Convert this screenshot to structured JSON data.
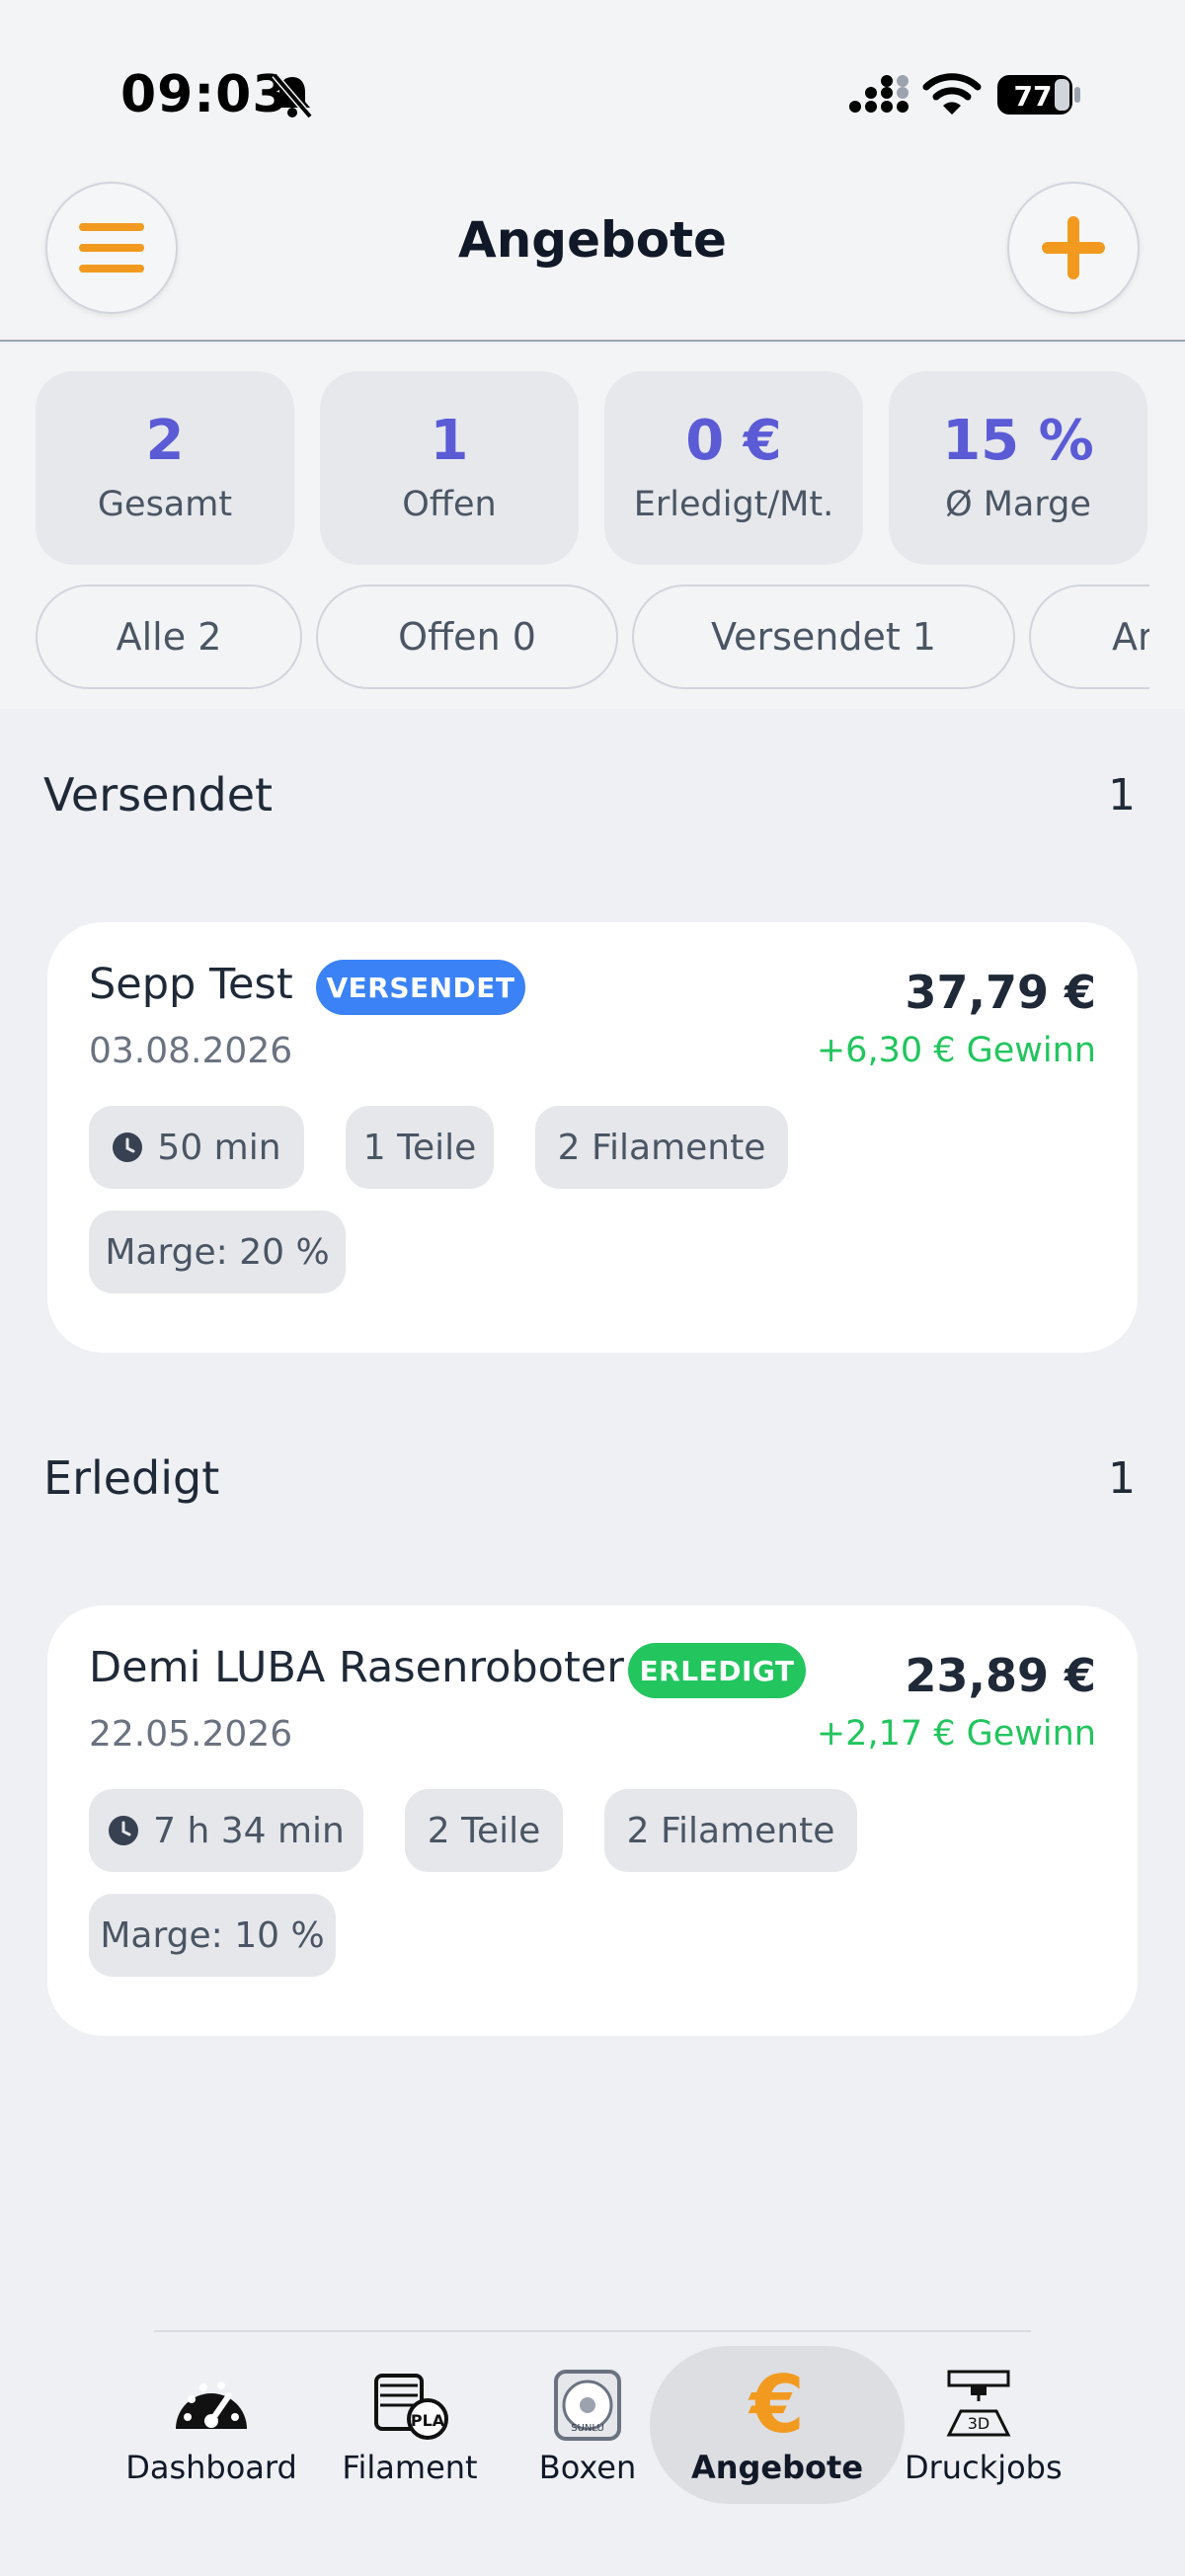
{
  "status_bar": {
    "time": "09:03",
    "battery": "77"
  },
  "header": {
    "title": "Angebote"
  },
  "stats": [
    {
      "value": "2",
      "label": "Gesamt"
    },
    {
      "value": "1",
      "label": "Offen"
    },
    {
      "value": "0 €",
      "label": "Erledigt/Mt."
    },
    {
      "value": "15 %",
      "label": "Ø Marge"
    }
  ],
  "filters": [
    "Alle 2",
    "Offen 0",
    "Versendet 1",
    "Ar"
  ],
  "sections": [
    {
      "title": "Versendet",
      "count": "1",
      "card": {
        "name": "Sepp Test",
        "badge": "VERSENDET",
        "date": "03.08.2026",
        "price": "37,79 €",
        "gain": "+6,30 € Gewinn",
        "time": "50 min",
        "parts": "1 Teile",
        "filaments": "2 Filamente",
        "margin": "Marge: 20 %"
      }
    },
    {
      "title": "Erledigt",
      "count": "1",
      "card": {
        "name": "Demi LUBA Rasenroboter",
        "badge": "ERLEDIGT",
        "date": "22.05.2026",
        "price": "23,89 €",
        "gain": "+2,17 € Gewinn",
        "time": "7 h 34 min",
        "parts": "2 Teile",
        "filaments": "2 Filamente",
        "margin": "Marge: 10 %"
      }
    }
  ],
  "nav": {
    "items": [
      {
        "label": "Dashboard",
        "icon": "speedometer-icon"
      },
      {
        "label": "Filament",
        "icon": "filament-spool-icon",
        "icon_text": "PLA"
      },
      {
        "label": "Boxen",
        "icon": "storage-box-icon",
        "icon_text": "SUNLU"
      },
      {
        "label": "Angebote",
        "icon": "euro-icon",
        "icon_text": "€",
        "active": true
      },
      {
        "label": "Druckjobs",
        "icon": "3d-printer-icon",
        "icon_text": "3D"
      }
    ]
  },
  "colors": {
    "accent": "#f29a1f",
    "stat_value": "#5b5bd6",
    "badge_sent": "#3b82f6",
    "badge_done": "#22c55e",
    "gain": "#22c55e"
  }
}
